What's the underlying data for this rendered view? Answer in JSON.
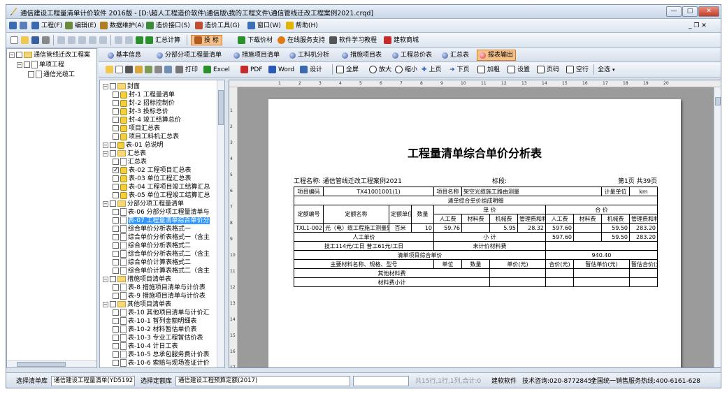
{
  "window": {
    "title": "通信建设工程量清单计价软件 2016版 - [D:\\超人工程造价软件\\通信版\\我的工程文件\\通信管线迁改工程案例2021.crqd]",
    "controls": {
      "minimize": "—",
      "maximize": "□",
      "close": "✕"
    },
    "doc_controls": "_ ❐ ✕"
  },
  "menu": [
    {
      "label": "工程(F)",
      "icon": "project-icon",
      "color": "#3a6ab0"
    },
    {
      "label": "编辑(E)",
      "icon": "edit-icon",
      "color": "#6c8a3c"
    },
    {
      "label": "数据维护(A)",
      "icon": "data-icon",
      "color": "#b0801f"
    },
    {
      "label": "造价接口(S)",
      "icon": "interface-icon",
      "color": "#3b8d3b"
    },
    {
      "label": "造价工具(G)",
      "icon": "tools-icon",
      "color": "#c14c2e"
    },
    {
      "label": "窗口(W)",
      "icon": "window-icon",
      "color": "#3b6fb8"
    },
    {
      "label": "帮助(H)",
      "icon": "help-icon",
      "color": "#e2b400"
    }
  ],
  "toolbar1": {
    "summary_label": "汇总计算",
    "bid_label": "投  标",
    "download_label": "下载价材",
    "online_label": "在线服务支持",
    "tutorial_label": "软件学习教程",
    "mall_label": "建软商城"
  },
  "left_tree": {
    "root": "通信管线迁改工程案",
    "child": "单项工程",
    "leaf": "通信光缆工"
  },
  "tabs": [
    {
      "label": "基本信息",
      "active": false
    },
    {
      "label": "分部分项工程量清单",
      "active": false
    },
    {
      "label": "措施项目清单",
      "active": false
    },
    {
      "label": "工料机分析",
      "active": false
    },
    {
      "label": "措施项目表",
      "active": false
    },
    {
      "label": "工程总价表",
      "active": false
    },
    {
      "label": "汇总表",
      "active": false
    },
    {
      "label": "报表输出",
      "active": true
    }
  ],
  "toolbar2": {
    "print": "打印",
    "excel": "Excel",
    "pdf": "PDF",
    "word": "Word",
    "design": "设计",
    "fullscreen": "全屏",
    "zoom_in": "放大",
    "zoom_out": "缩小",
    "prev": "上页",
    "next": "下页",
    "bold": "加粗",
    "settings": "设置",
    "page_no": "页码",
    "blank_row": "空行",
    "select_all": "全选"
  },
  "report_tree": [
    {
      "label": "封面",
      "type": "folder",
      "level": 0,
      "toggle": "−"
    },
    {
      "label": "封-1 工程量清单",
      "type": "warn",
      "level": 1
    },
    {
      "label": "封-2 招标控制价",
      "type": "warn",
      "level": 1
    },
    {
      "label": "封-3 投标总价",
      "type": "warn",
      "level": 1
    },
    {
      "label": "封-4 竣工结算总价",
      "type": "warn",
      "level": 1
    },
    {
      "label": "项目汇总表",
      "type": "warn",
      "level": 1
    },
    {
      "label": "项目工料机汇总表",
      "type": "warn",
      "level": 1
    },
    {
      "label": "表-01 总说明",
      "type": "warn",
      "level": 0,
      "toggle": "−"
    },
    {
      "label": "汇总表",
      "type": "folder",
      "level": 0,
      "toggle": "−"
    },
    {
      "label": "汇总表",
      "type": "doc",
      "level": 1
    },
    {
      "label": "表-02 工程项目汇总表",
      "type": "warn",
      "level": 1,
      "checked": true
    },
    {
      "label": "表-03 单位工程汇总表",
      "type": "warn",
      "level": 1
    },
    {
      "label": "表-04 工程项目竣工结算汇总",
      "type": "warn",
      "level": 1
    },
    {
      "label": "表-05 单位工程竣工结算汇总",
      "type": "warn",
      "level": 1
    },
    {
      "label": "分部分项工程量清单",
      "type": "folder",
      "level": 0,
      "toggle": "−"
    },
    {
      "label": "表-06 分部分项工程量清单与",
      "type": "doc",
      "level": 1
    },
    {
      "label": "表-07 工程量清单综合单价分",
      "type": "doc",
      "level": 1,
      "selected": true
    },
    {
      "label": "综合单价分析表格式一",
      "type": "doc",
      "level": 1
    },
    {
      "label": "综合单价分析表格式一（含主",
      "type": "doc",
      "level": 1
    },
    {
      "label": "综合单价分析表格式二",
      "type": "doc",
      "level": 1
    },
    {
      "label": "综合单价分析表格式二（含主",
      "type": "doc",
      "level": 1
    },
    {
      "label": "综合单价计算表格式二",
      "type": "doc",
      "level": 1
    },
    {
      "label": "综合单价计算表格式二（含主",
      "type": "doc",
      "level": 1
    },
    {
      "label": "措施项目清单表",
      "type": "folder",
      "level": 0,
      "toggle": "−"
    },
    {
      "label": "表-8 措施项目清单与计价表",
      "type": "doc",
      "level": 1
    },
    {
      "label": "表-9 措施项目清单与计价表",
      "type": "doc",
      "level": 1
    },
    {
      "label": "其他项目清单表",
      "type": "folder",
      "level": 0,
      "toggle": "−"
    },
    {
      "label": "表-10 其他项目清单与计价汇",
      "type": "doc",
      "level": 1
    },
    {
      "label": "表-10-1 暂列金额明细表",
      "type": "doc",
      "level": 1
    },
    {
      "label": "表-10-2 材料暂估单价表",
      "type": "doc",
      "level": 1
    },
    {
      "label": "表-10-3 专业工程暂估价表",
      "type": "doc",
      "level": 1
    },
    {
      "label": "表-10-4 计日工表",
      "type": "doc",
      "level": 1
    },
    {
      "label": "表-10-5 总承包服务费计价表",
      "type": "doc",
      "level": 1
    },
    {
      "label": "表-10-6 索赔与现场签证计价",
      "type": "doc",
      "level": 1
    }
  ],
  "ruler_labels": [
    "1",
    "2",
    "3",
    "4",
    "5",
    "6",
    "7",
    "8",
    "9",
    "10",
    "11",
    "12",
    "13",
    "14",
    "15",
    "16",
    "17",
    "18",
    "19",
    "20"
  ],
  "vruler_labels": [
    "1",
    "2",
    "3",
    "4",
    "5",
    "6",
    "7",
    "8",
    "9",
    "10",
    "11",
    "12",
    "13",
    "14",
    "15",
    "16",
    "17"
  ],
  "report": {
    "title": "工程量清单综合单价分析表",
    "project_label": "工程名称:",
    "project_name": "通信管线迁改工程案例2021",
    "section_label": "标段:",
    "page_info": "第1页 共39页",
    "row_item_code_label": "项目编码",
    "item_code": "TX41001001(1)",
    "row_item_name_label": "项目名称",
    "item_name": "架空光缆施工路由测量",
    "row_unit_label": "计量单位",
    "unit": "km",
    "composition_title": "清单综合单价组成明细",
    "h_quota_code": "定额编号",
    "h_quota_name": "定额名称",
    "h_quota_unit": "定额单位",
    "h_qty": "数量",
    "h_unit_price": "单  价",
    "h_total_price": "合  价",
    "h_labor": "人工费",
    "h_material": "材料费",
    "h_machine": "机械费",
    "h_mgmt": "管理费和利润",
    "row1": {
      "code": "TXL1-002",
      "name": "光（电）缆工程施工测量架空",
      "unit": "百米",
      "qty": "10",
      "u_labor": "59.76",
      "u_material": "",
      "u_machine": "5.95",
      "u_mgmt": "28.32",
      "t_labor": "597.60",
      "t_material": "",
      "t_machine": "59.50",
      "t_mgmt": "283.20"
    },
    "labor_price_label": "人工单价",
    "subtotal_label": "小  计",
    "subtotal": {
      "labor": "597.60",
      "material": "",
      "machine": "59.50",
      "mgmt": "283.20"
    },
    "labor_rates": "技工114元/工日 普工61元/工日",
    "unpriced_material_label": "未计价材料费",
    "unit_price_label": "清单项目综合单价",
    "unit_price_value": "940.40",
    "mat_header": "主要材料名称、规格、型号",
    "mat_unit": "单位",
    "mat_qty": "数量",
    "mat_price": "单价(元)",
    "mat_total": "合价(元)",
    "mat_est_price": "暂估单价(元)",
    "mat_est_total": "暂估合价(元)",
    "other_material": "其他材料费",
    "material_subtotal": "材料费小计"
  },
  "status": {
    "library_label": "选择清单库",
    "library_value": "通信建设工程量清单(YD5192",
    "quota_label": "选择定额库",
    "quota_value": "通信建设工程预算定额(2017)",
    "count_text": "共15行,1行,1列,合计:0",
    "company": "建软软件",
    "consult": "技术咨询:020-87728457",
    "hotline": "全国统一销售服务热线:400-6161-628"
  },
  "colors": {
    "active_tab_bg": "#f5c08a",
    "selected_item_bg": "#3399ff",
    "toolbar_bg": "#dbe4ef",
    "page_bg": "#9b9b9b"
  }
}
